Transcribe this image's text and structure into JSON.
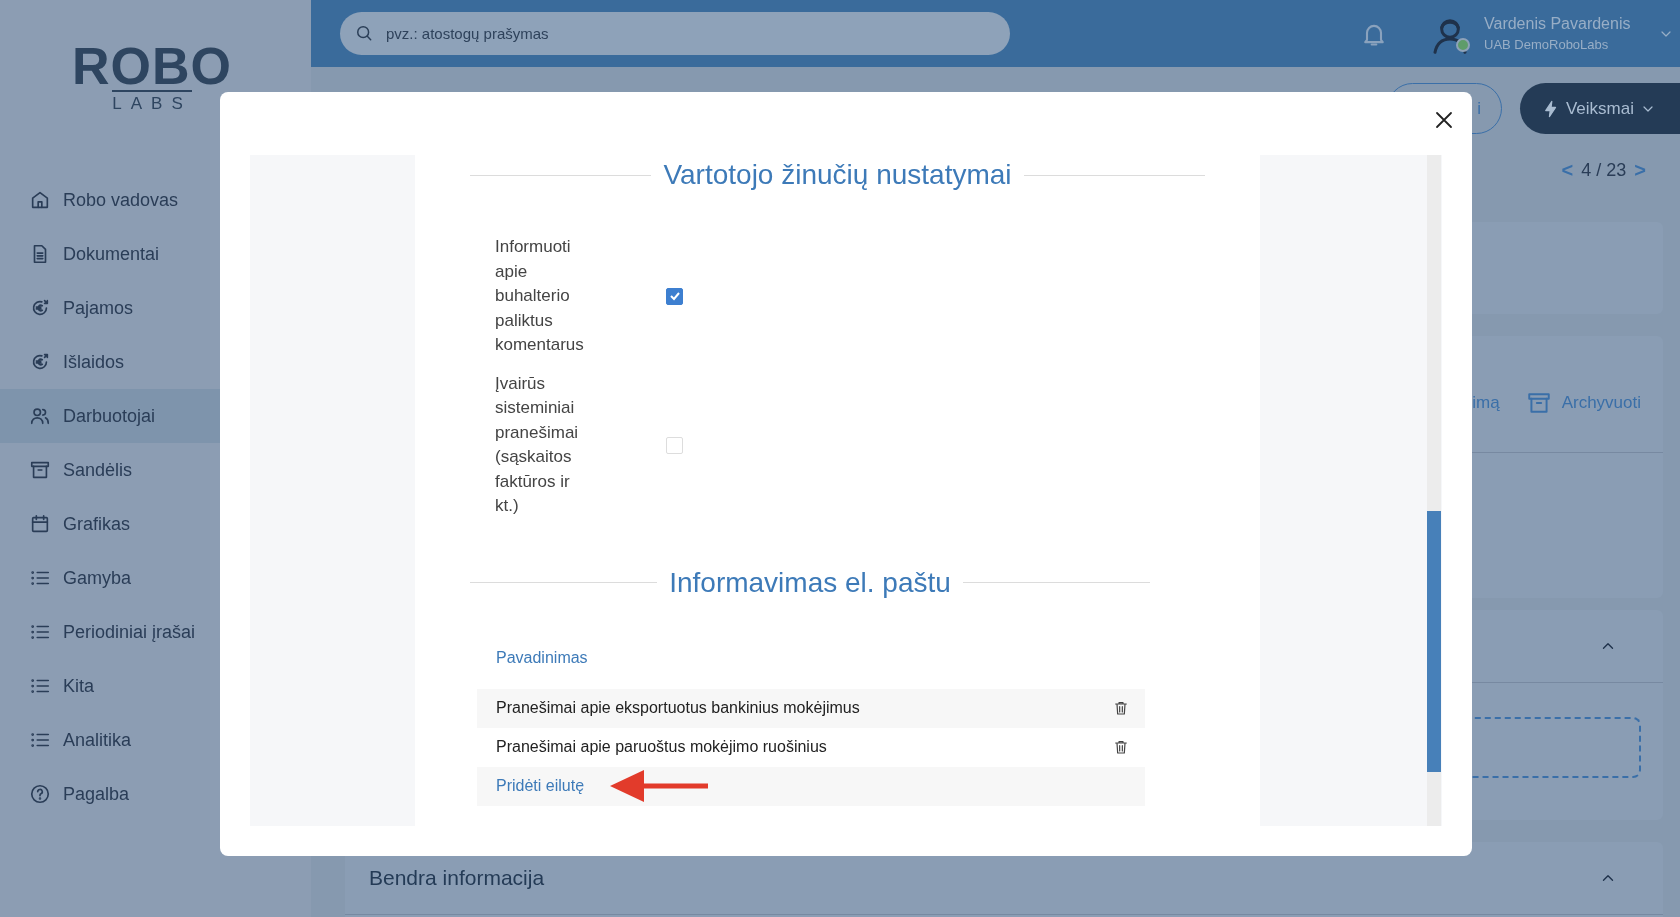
{
  "sidebar": {
    "logo": {
      "word": "ROBO",
      "subword": "LABS"
    },
    "items": [
      {
        "label": "Robo vadovas",
        "kind": "home",
        "selected": false
      },
      {
        "label": "Dokumentai",
        "kind": "document",
        "selected": false
      },
      {
        "label": "Pajamos",
        "kind": "income",
        "selected": false
      },
      {
        "label": "Išlaidos",
        "kind": "expense",
        "selected": false
      },
      {
        "label": "Darbuotojai",
        "kind": "users",
        "selected": true
      },
      {
        "label": "Sandėlis",
        "kind": "archive",
        "selected": false
      },
      {
        "label": "Grafikas",
        "kind": "calendar",
        "selected": false
      },
      {
        "label": "Gamyba",
        "kind": "list",
        "selected": false
      },
      {
        "label": "Periodiniai įrašai",
        "kind": "list",
        "selected": false
      },
      {
        "label": "Kita",
        "kind": "list",
        "selected": false
      },
      {
        "label": "Analitika",
        "kind": "list",
        "selected": false
      },
      {
        "label": "Pagalba",
        "kind": "help",
        "selected": false
      }
    ]
  },
  "top_bar": {
    "search": {
      "placeholder": "pvz.: atostogų prašymas"
    },
    "user": {
      "name": "Vardenis Pavardenis",
      "company": "UAB DemoRoboLabs"
    }
  },
  "toolbar": {
    "buttons": [
      {
        "label": "i",
        "kind": "outline"
      },
      {
        "label": "Veiksmai",
        "kind": "primary"
      }
    ]
  },
  "pager": {
    "prev": "<",
    "position": "4 / 23",
    "next": ">"
  },
  "actions": [
    {
      "label": "imą",
      "kind": "plain"
    },
    {
      "label": "Archyvuoti",
      "kind": "archive"
    }
  ],
  "section": {
    "title": "Bendra informacija"
  },
  "modal": {
    "sections": [
      {
        "title": "Vartotojo žinučių nustatymai",
        "settings": [
          {
            "label": "Informuoti apie buhalterio paliktus komentarus",
            "checked": true
          },
          {
            "label": "Įvairūs sisteminiai pranešimai (sąskaitos faktūros ir kt.)",
            "checked": false
          }
        ]
      },
      {
        "title": "Informavimas el. paštu",
        "table": {
          "column": "Pavadinimas",
          "rows": [
            "Pranešimai apie eksportuotus bankinius mokėjimus",
            "Pranešimai apie paruoštus mokėjimo ruošinius"
          ],
          "add_link": "Pridėti eilutę"
        }
      }
    ]
  }
}
